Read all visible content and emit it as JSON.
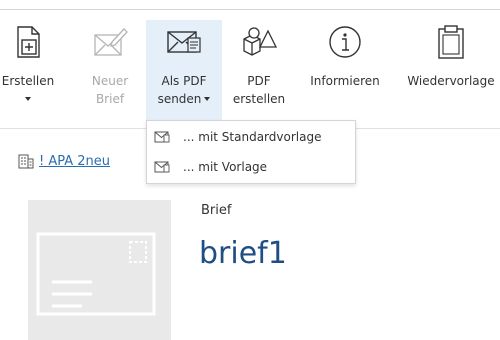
{
  "toolbar": {
    "erstellen": {
      "line1": "Erstellen",
      "icon": "new-document-icon"
    },
    "neuer_brief": {
      "line1": "Neuer",
      "line2": "Brief",
      "icon": "letter-edit-icon",
      "disabled": true
    },
    "als_pdf_senden": {
      "line1": "Als PDF",
      "line2": "senden",
      "icon": "email-attachment-icon",
      "active": true
    },
    "pdf_erstellen": {
      "line1": "PDF",
      "line2": "erstellen",
      "icon": "shapes-icon"
    },
    "informieren": {
      "line1": "Informieren",
      "icon": "info-icon"
    },
    "wiedervorlage": {
      "line1": "Wiedervorlage",
      "icon": "clipboard-icon"
    }
  },
  "dropdown": {
    "items": [
      {
        "label": "... mit Standardvorlage",
        "icon": "email-attachment-icon"
      },
      {
        "label": "... mit Vorlage",
        "icon": "email-attachment-icon"
      }
    ]
  },
  "breadcrumb": {
    "label": "! APA 2neu",
    "icon": "building-icon"
  },
  "document": {
    "type": "Brief",
    "title": "brief1"
  },
  "colors": {
    "active_bg": "#e4eff9",
    "link": "#2a6db0",
    "title": "#1f4e86",
    "disabled_text": "#a8a8a8"
  }
}
